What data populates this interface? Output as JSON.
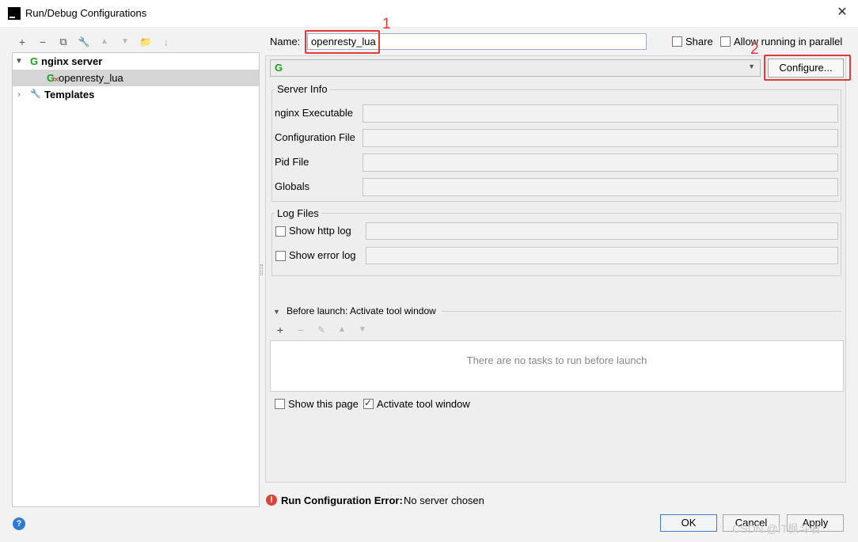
{
  "window": {
    "title": "Run/Debug Configurations",
    "close": "✕",
    "app_icon": "IJ"
  },
  "toolbar": [
    {
      "name": "add-icon",
      "glyph": "+",
      "disabled": false
    },
    {
      "name": "remove-icon",
      "glyph": "−",
      "disabled": false
    },
    {
      "name": "copy-icon",
      "glyph": "⧉",
      "disabled": false
    },
    {
      "name": "wrench-icon",
      "glyph": "🔧",
      "disabled": false
    },
    {
      "name": "move-up-icon",
      "glyph": "▲",
      "disabled": true
    },
    {
      "name": "move-down-icon",
      "glyph": "▼",
      "disabled": true
    },
    {
      "name": "folder-icon",
      "glyph": "📁",
      "disabled": false
    },
    {
      "name": "sort-icon",
      "glyph": "↓",
      "disabled": true
    }
  ],
  "tree": {
    "group": "nginx server",
    "child": "openresty_lua",
    "templates": "Templates",
    "g_glyph": "G",
    "x_glyph": "✕",
    "wrench_glyph": "🔧"
  },
  "form": {
    "name_label": "Name:",
    "name_value": "openresty_lua",
    "share_label": "Share",
    "parallel_label": "Allow running in parallel",
    "configure_button": "Configure...",
    "combo_glyph": "G",
    "server_info_title": "Server Info",
    "nginx_exe_label": "nginx Executable",
    "config_file_label": "Configuration File",
    "pid_file_label": "Pid File",
    "globals_label": "Globals",
    "log_files_title": "Log Files",
    "show_http_log": "Show http log",
    "show_error_log": "Show error log",
    "before_launch": "Before launch: Activate tool window",
    "no_tasks": "There are no tasks to run before launch",
    "show_this_page": "Show this page",
    "activate_tool_window": "Activate tool window"
  },
  "annotations": {
    "num1": "1",
    "num2": "2",
    "color": "#e53935"
  },
  "status": {
    "error_bold": "Run Configuration Error:",
    "error_text": "No server chosen",
    "error_glyph": "!"
  },
  "buttons": {
    "ok": "OK",
    "cancel": "Cancel",
    "apply": "Apply",
    "help_glyph": "?"
  },
  "watermark": "CSDN @IT枫斗者",
  "colors": {
    "nginx_green": "#1a9e1a",
    "error_red": "#d9443b",
    "help_blue": "#2d7bd5"
  }
}
